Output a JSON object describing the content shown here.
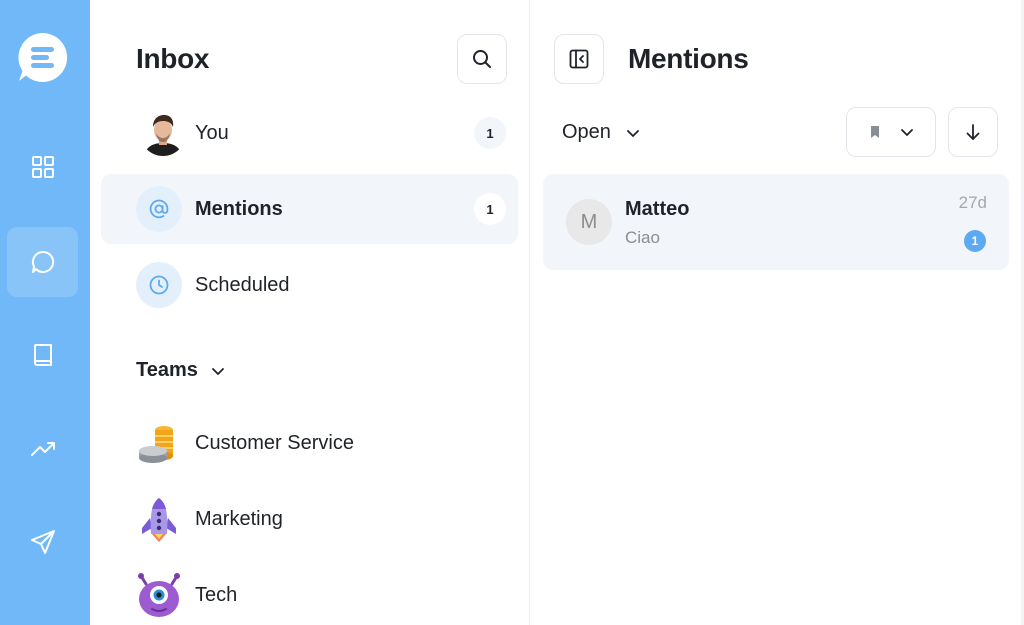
{
  "colors": {
    "rail": "#70b8f7",
    "active_row": "#f2f6fa",
    "accent_badge": "#5daaf2",
    "text": "#1f2329",
    "muted": "#8a8d91"
  },
  "rail": {
    "logo": "chat-logo-icon",
    "items": [
      {
        "icon": "grid-icon",
        "active": false
      },
      {
        "icon": "chat-bubble-icon",
        "active": true
      },
      {
        "icon": "book-icon",
        "active": false
      },
      {
        "icon": "trending-up-icon",
        "active": false
      },
      {
        "icon": "send-icon",
        "active": false
      }
    ]
  },
  "inbox": {
    "title": "Inbox",
    "search_icon": "search-icon",
    "items": [
      {
        "label": "You",
        "count": "1",
        "icon": "user-avatar"
      },
      {
        "label": "Mentions",
        "count": "1",
        "icon": "at-sign-icon",
        "active": true
      },
      {
        "label": "Scheduled",
        "icon": "clock-icon"
      }
    ],
    "teams_label": "Teams",
    "teams": [
      {
        "label": "Customer Service",
        "icon": "coins-emoji-icon"
      },
      {
        "label": "Marketing",
        "icon": "rocket-emoji-icon"
      },
      {
        "label": "Tech",
        "icon": "purple-monster-icon"
      }
    ]
  },
  "mentions": {
    "title": "Mentions",
    "collapse_icon": "collapse-panel-icon",
    "filter_label": "Open",
    "bookmark_icon": "bookmark-icon",
    "sort_icon": "arrow-down-icon",
    "conversations": [
      {
        "avatar_initial": "M",
        "name": "Matteo",
        "preview": "Ciao",
        "time": "27d",
        "unread": "1"
      }
    ]
  }
}
